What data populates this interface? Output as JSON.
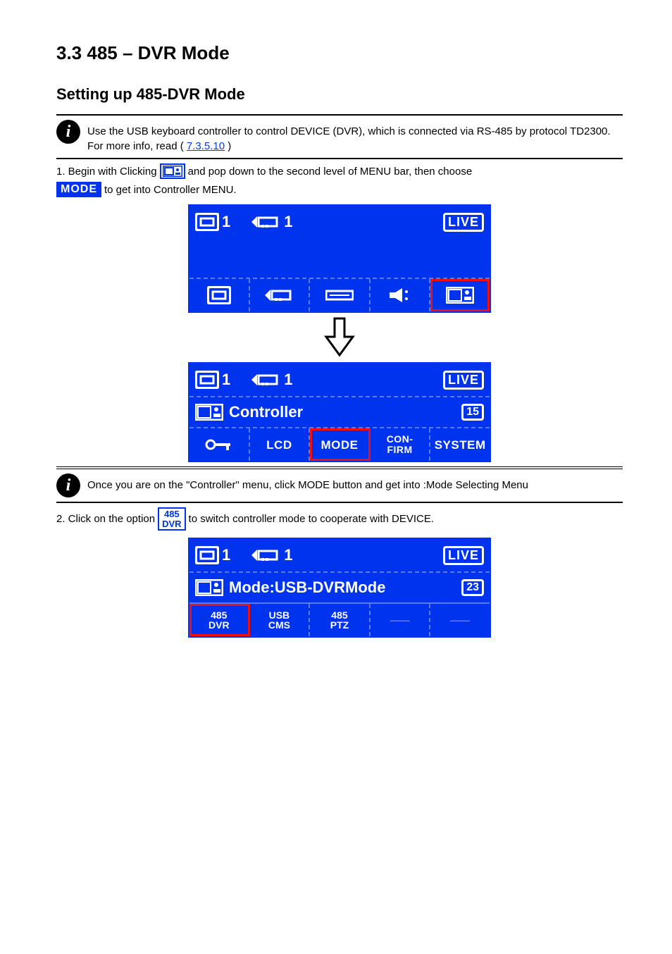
{
  "page": {
    "title": "3.3 485 – DVR Mode",
    "section_header": "Setting up 485-DVR Mode"
  },
  "info1": {
    "text_before": "Use the USB keyboard controller to control DEVICE (DVR), which is connected via RS-485 by protocol TD2300. For more info, read (",
    "link": "7.3.5.10",
    "text_after": ")"
  },
  "intro": {
    "line1_before": "1. Begin with Clicking",
    "line1_after": "and pop down to the second level of MENU bar, then choose",
    "line2_after": "to get into Controller MENU."
  },
  "chips": {
    "mode_label": "MODE",
    "dvr485_label_line1": "485",
    "dvr485_label_line2": "DVR"
  },
  "lcd1": {
    "monitor_num": "1",
    "proj_num": "1",
    "live": "LIVE"
  },
  "buttons_row1": {
    "items": [
      "monitor-icon",
      "proj-icon",
      "keyb-icon",
      "speaker-icon",
      "ctrl-icon"
    ]
  },
  "lcd2": {
    "monitor_num": "1",
    "proj_num": "1",
    "live": "LIVE",
    "content_label": "Controller",
    "content_badge": "15",
    "buttons": [
      "key-icon",
      "LCD",
      "MODE",
      "CON-\nFIRM",
      "SYSTEM"
    ]
  },
  "info2": {
    "text_before": "Once you are on the \"Controller\" menu, click MODE button and get into :Mode Selecting Menu"
  },
  "intro2": {
    "line_before": "2. Click on the option",
    "line_after": "to switch controller mode to cooperate with DEVICE."
  },
  "lcd3": {
    "monitor_num": "1",
    "proj_num": "1",
    "live": "LIVE",
    "content_label": "Mode:USB-DVRMode",
    "content_badge": "23",
    "modes": [
      "485\nDVR",
      "USB\nCMS",
      "485\nPTZ",
      "",
      ""
    ]
  }
}
